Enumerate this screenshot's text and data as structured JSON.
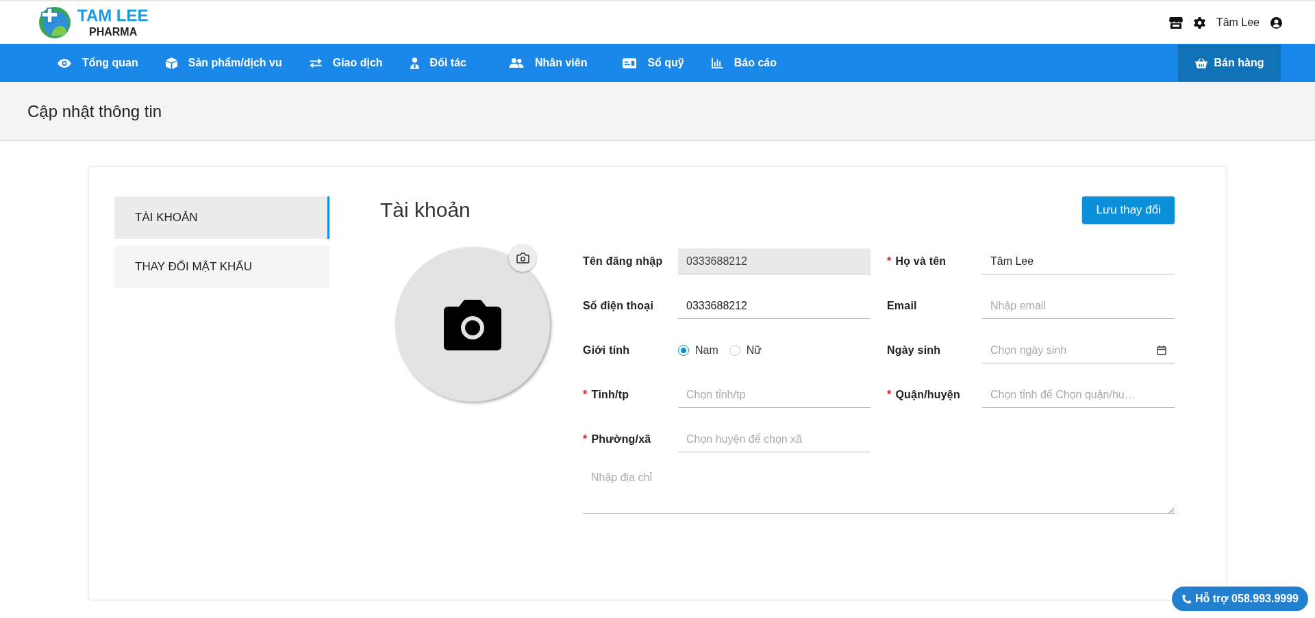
{
  "header": {
    "logo": {
      "name": "TAM LEE",
      "sub": "PHARMA"
    },
    "user": "Tâm Lee"
  },
  "nav": {
    "items": [
      {
        "label": "Tổng quan"
      },
      {
        "label": "Sản phẩm/dịch vu"
      },
      {
        "label": "Giao dịch"
      },
      {
        "label": "Đối tác"
      },
      {
        "label": "Nhân viên"
      },
      {
        "label": "Sổ quỹ"
      },
      {
        "label": "Báo cáo"
      }
    ],
    "sell_button": "Bán hàng"
  },
  "page_title": "Cập nhật thông tin",
  "sidebar": {
    "items": [
      {
        "label": "TÀI KHOẢN",
        "selected": true
      },
      {
        "label": "THAY ĐỔI MẬT KHẨU",
        "selected": false
      }
    ]
  },
  "account": {
    "title": "Tài khoản",
    "save_button": "Lưu thay đổi",
    "fields": [
      {
        "kind": "text",
        "label": "Tên đăng nhập",
        "value": "0333688212",
        "disabled": true
      },
      {
        "kind": "text",
        "label": "Họ và tên",
        "mark": "*",
        "value": "Tâm Lee",
        "disabled": false
      },
      {
        "kind": "text",
        "label": "Số điện thoại",
        "value": "0333688212",
        "disabled": false
      },
      {
        "kind": "text",
        "label": "Email",
        "placeholder": "Nhập email",
        "disabled": false
      },
      {
        "kind": "radio",
        "label": "Giới tính",
        "options": [
          {
            "label": "Nam",
            "selected": true
          },
          {
            "label": "Nữ",
            "selected": false
          }
        ]
      },
      {
        "kind": "date",
        "label": "Ngày sinh",
        "placeholder": "Chọn ngày sinh"
      },
      {
        "kind": "select",
        "label": "Tỉnh/tp",
        "mark": "*",
        "placeholder": "Chọn tỉnh/tp"
      },
      {
        "kind": "select",
        "label": "Quận/huyện",
        "mark": "*",
        "placeholder": "Chọn tỉnh để Chọn quận/hu…"
      },
      {
        "kind": "select",
        "label": "Phường/xã",
        "mark": "*",
        "placeholder": "Chọn huyện để chọn xã"
      }
    ],
    "address": {
      "placeholder": "Nhập địa chỉ"
    }
  },
  "support_button": "Hỗ trợ 058.993.9999"
}
